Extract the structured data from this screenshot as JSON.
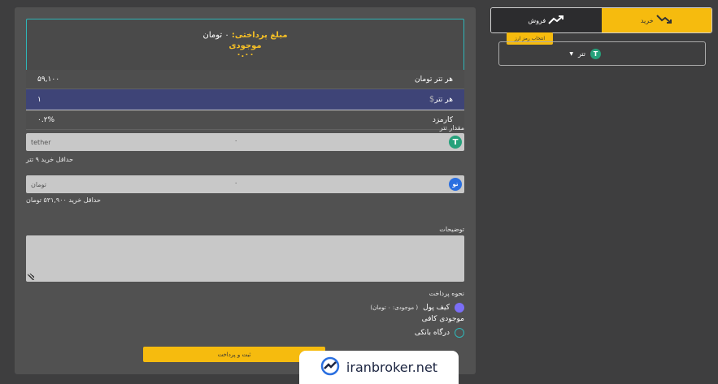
{
  "summary": {
    "payment_label": "مبلغ پرداختی:",
    "payment_value": "۰ تومان",
    "balance_label": "موجودی",
    "balance_value": "۰.۰۰"
  },
  "rates": [
    {
      "label": "هر تتر تومان",
      "value": "۵۹,۱۰۰"
    },
    {
      "label": "هر تتر",
      "value": "۱"
    },
    {
      "label": "کارمزد",
      "value": "۰.۲%"
    }
  ],
  "tether_field": {
    "label": "مقدار تتر",
    "name": "tether",
    "value": "۰",
    "hint": "حداقل خرید ۹ تتر"
  },
  "toman_field": {
    "name": "تومان",
    "value": "۰",
    "hint": "حداقل خرید ۵۳۱,۹۰۰ تومان",
    "icon_text": "تو"
  },
  "description": {
    "label": "توضیحات"
  },
  "payment_method": {
    "label": "نحوه پرداخت",
    "wallet_label": "کیف پول",
    "wallet_sub": "( موجودی: ۰ تومان)",
    "sufficient": "موجودی کافی",
    "gateway_label": "درگاه بانکی"
  },
  "submit_label": "ثبت و پرداخت",
  "tabs": {
    "buy": "خرید",
    "sell": "فروش"
  },
  "tooltip": "انتخاب رمز ارز",
  "coin_select": {
    "label": "تتر",
    "icon_text": "T"
  },
  "watermark": "iranbroker.net",
  "colors": {
    "accent": "#f6bb0e",
    "teal": "#2fb6b8",
    "tether": "#26a17b",
    "radio": "#7b6ef6"
  }
}
